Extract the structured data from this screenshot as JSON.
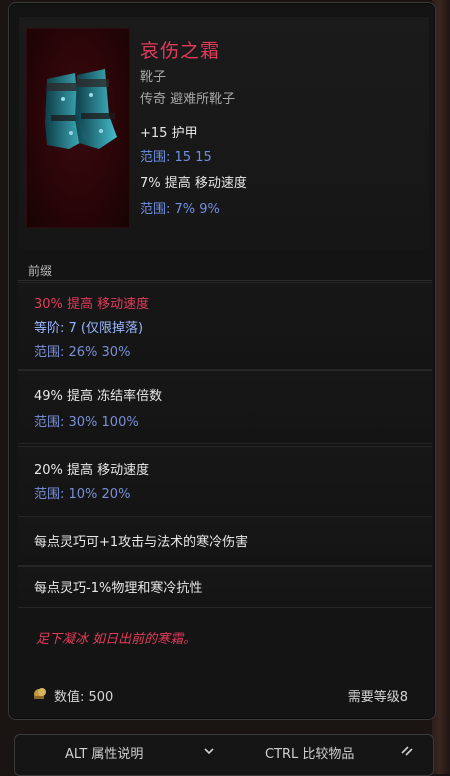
{
  "item": {
    "name": "哀伤之霜",
    "type": "靴子",
    "rarity_base": "传奇 避难所靴子",
    "implicits": [
      {
        "text": "+15 护甲",
        "range": "范围: 15  15"
      },
      {
        "text": "7% 提高 移动速度",
        "range": "范围: 7%  9%"
      }
    ]
  },
  "prefix_label": "前缀",
  "affixes": [
    {
      "line1": "30% 提高 移动速度",
      "line2": "等阶: 7  (仅限掉落)",
      "range": "范围: 26%  30%"
    },
    {
      "line1": "49% 提高 冻结率倍数",
      "range": "范围: 30%  100%"
    },
    {
      "line1": "20% 提高 移动速度",
      "range": "范围: 10%  20%"
    }
  ],
  "unique_mods": [
    "每点灵巧可+1攻击与法术的寒冷伤害",
    "每点灵巧-1%物理和寒冷抗性"
  ],
  "lore": "足下凝冰 如日出前的寒霜。",
  "footer": {
    "value_label": "数值: 500",
    "level_label": "需要等级8"
  },
  "bottom_bar": {
    "left_label": "ALT 属性说明",
    "right_label": "CTRL 比较物品"
  },
  "colors": {
    "accent_red": "#e23b5a",
    "range_blue": "#6f8fe0",
    "text_white": "#e6e6e6"
  }
}
